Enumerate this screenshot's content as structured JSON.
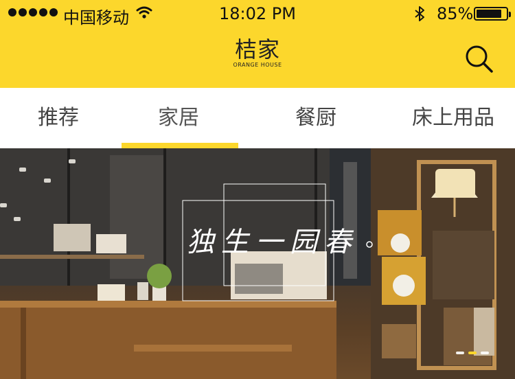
{
  "status": {
    "carrier": "中国移动",
    "time": "18:02 PM",
    "battery": "85%",
    "battery_level": 0.85
  },
  "header": {
    "logo_cn": "桔家",
    "logo_en": "ORANGE HOUSE",
    "search_icon": "search-icon"
  },
  "tabs": [
    {
      "label": "推荐",
      "active": false
    },
    {
      "label": "家居",
      "active": true
    },
    {
      "label": "餐厨",
      "active": false
    },
    {
      "label": "床上用品",
      "active": false
    }
  ],
  "banner": {
    "tagline": "独生一园春",
    "page_count": 3,
    "active_index": 1
  },
  "colors": {
    "accent": "#fcd72c",
    "tab_text": "#444444"
  }
}
